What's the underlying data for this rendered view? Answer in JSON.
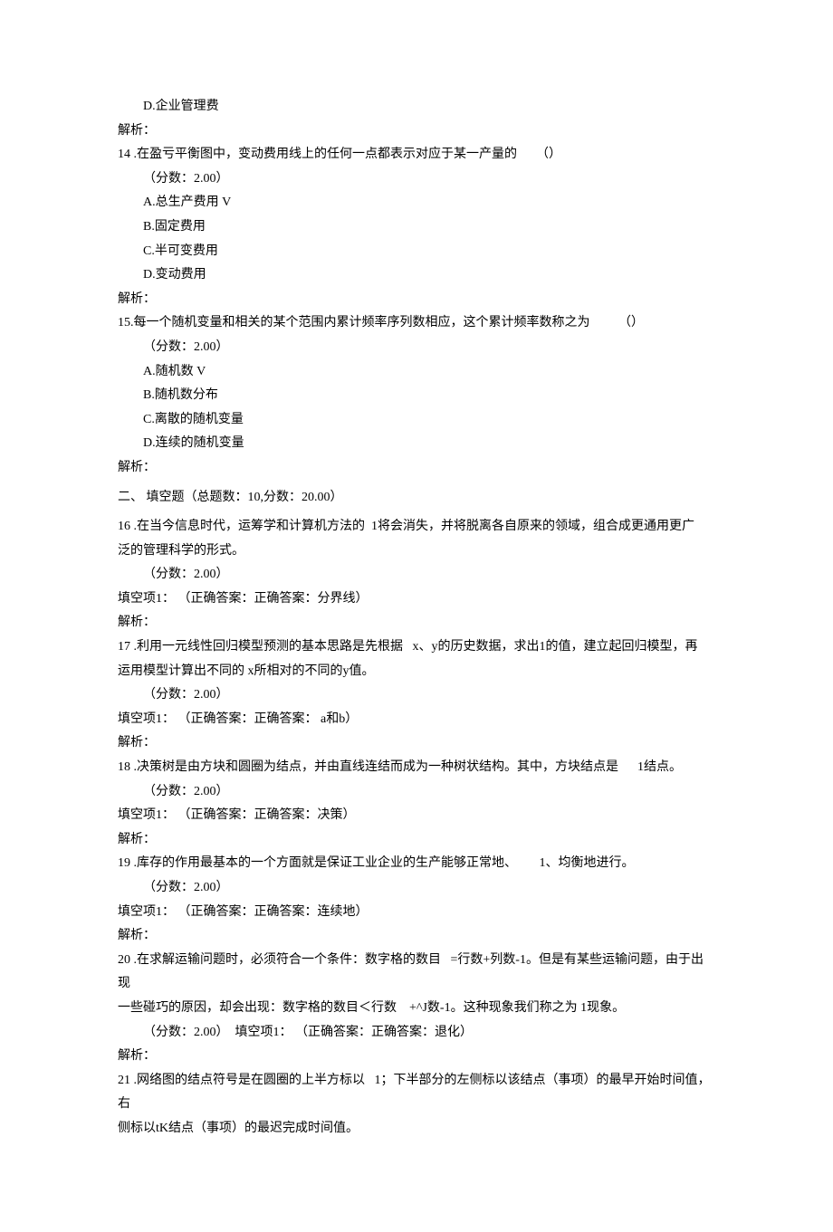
{
  "l1": "D.企业管理费",
  "l2": "解析：",
  "l3": "14 .在盈亏平衡图中，变动费用线上的任何一点都表示对应于某一产量的      （）",
  "l4": "（分数：2.00）",
  "l5": "A.总生产费用 V",
  "l6": "B.固定费用",
  "l7": "C.半可变费用",
  "l8": "D.变动费用",
  "l9": "解析：",
  "l10": "15.每一个随机变量和相关的某个范围内累计频率序列数相应，这个累计频率数称之为         （）",
  "l11": "（分数：2.00）",
  "l12": "A.随机数 V",
  "l13": "B.随机数分布",
  "l14": "C.离散的随机变量",
  "l15": "D.连续的随机变量",
  "l16": "解析：",
  "l17": "二、 填空题（总题数：10,分数：20.00）",
  "l18": "16 .在当今信息时代，运筹学和计算机方法的  1将会消失，并将脱离各自原来的领域，组合成更通用更广",
  "l19": "泛的管理科学的形式。",
  "l20": "（分数：2.00）",
  "l21": "填空项1： （正确答案：正确答案：分界线）",
  "l22": "解析：",
  "l23": "17 .利用一元线性回归模型预测的基本思路是先根据   x、y的历史数据，求出1的值，建立起回归模型，再",
  "l24": "运用模型计算出不同的 x所相对的不同的y值。",
  "l25": "（分数：2.00）",
  "l26": "填空项1： （正确答案：正确答案： a和b）",
  "l27": "解析：",
  "l28": "18 .决策树是由方块和圆圈为结点，并由直线连结而成为一种树状结构。其中，方块结点是      1结点。",
  "l29": "（分数：2.00）",
  "l30": "填空项1： （正确答案：正确答案：决策）",
  "l31": "解析：",
  "l32": "19 .库存的作用最基本的一个方面就是保证工业企业的生产能够正常地、       1、均衡地进行。",
  "l33": "（分数：2.00）",
  "l34": "填空项1： （正确答案：正确答案：连续地）",
  "l35": "解析：",
  "l36": "20 .在求解运输问题时，必须符合一个条件：数字格的数目   =行数+列数-1。但是有某些运输问题，由于出现",
  "l37": "一些碰巧的原因，却会出现：数字格的数目＜行数    +^J数-1。这种现象我们称之为 1现象。",
  "l38": "（分数：2.00）  填空项1： （正确答案：正确答案：退化）",
  "l39": "解析：",
  "l40": "21 .网络图的结点符号是在圆圈的上半方标以   1；下半部分的左侧标以该结点（事项）的最早开始时间值， 右",
  "l41": "侧标以tK结点（事项）的最迟完成时间值。"
}
